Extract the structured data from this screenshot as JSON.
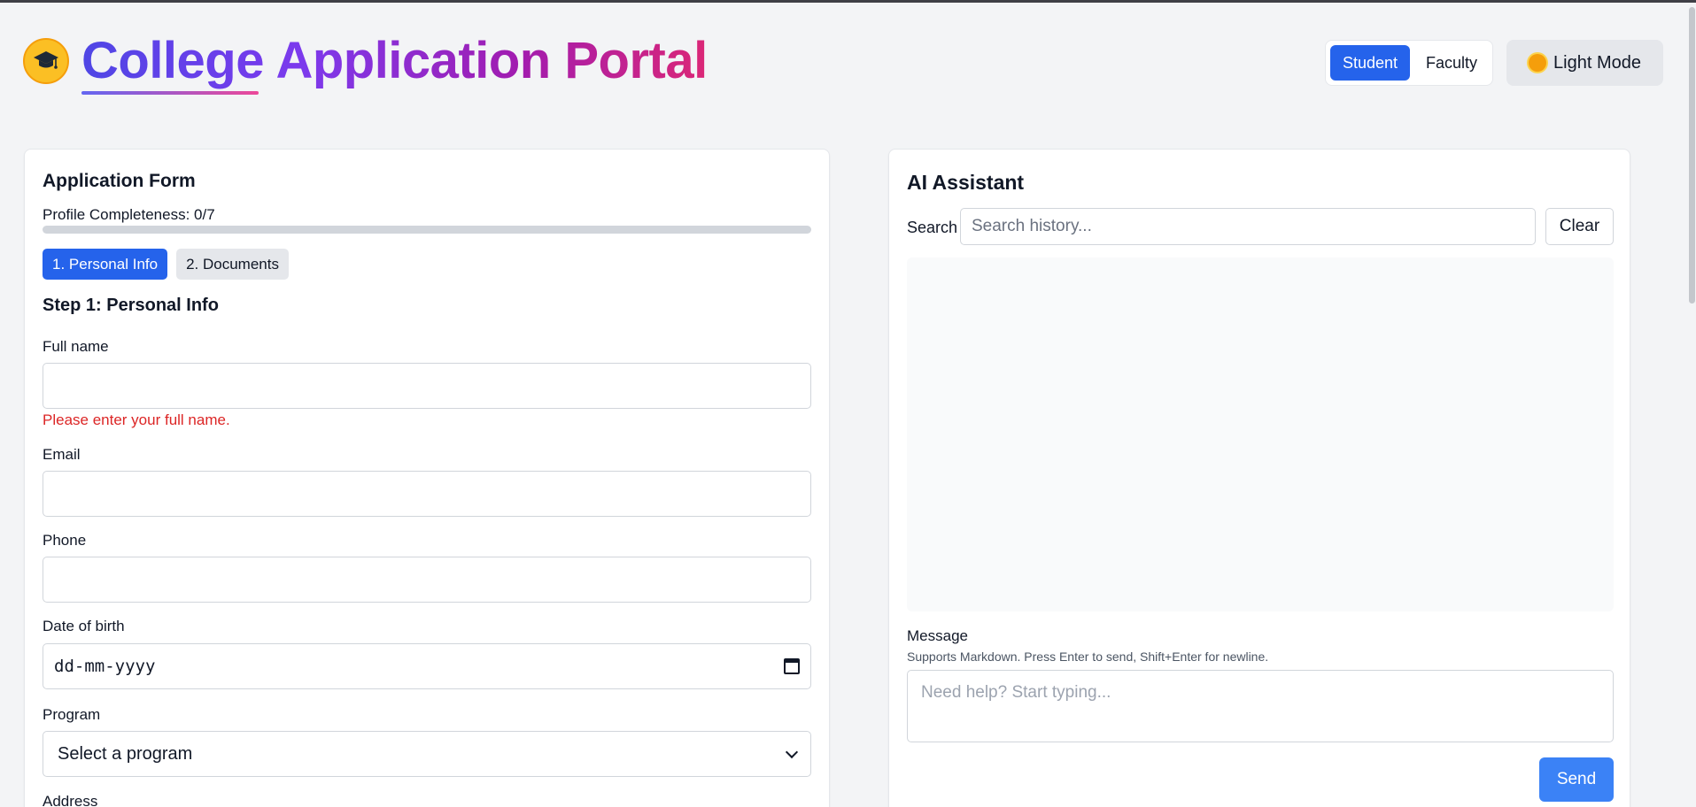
{
  "header": {
    "title": "College Application Portal",
    "logo_icon": "graduation-cap-icon",
    "roles": [
      "Student",
      "Faculty"
    ],
    "active_role": "Student",
    "mode_label": "Light Mode",
    "mode_icon": "sun-icon"
  },
  "form": {
    "title": "Application Form",
    "progress_label": "Profile Completeness: 0/7",
    "progress_fraction": 0,
    "steps": [
      "1. Personal Info",
      "2. Documents"
    ],
    "active_step": "1. Personal Info",
    "step_heading": "Step 1: Personal Info",
    "fields": {
      "full_name": {
        "label": "Full name",
        "value": "",
        "error": "Please enter your full name."
      },
      "email": {
        "label": "Email",
        "value": ""
      },
      "phone": {
        "label": "Phone",
        "value": ""
      },
      "dob": {
        "label": "Date of birth",
        "placeholder": "dd-mm-yyyy"
      },
      "program": {
        "label": "Program",
        "selected": "Select a program"
      },
      "address": {
        "label": "Address"
      }
    }
  },
  "assistant": {
    "title": "AI Assistant",
    "search_label": "Search",
    "search_placeholder": "Search history...",
    "clear_label": "Clear",
    "message_label": "Message",
    "message_hint": "Supports Markdown. Press Enter to send, Shift+Enter for newline.",
    "message_placeholder": "Need help? Start typing...",
    "send_label": "Send"
  },
  "colors": {
    "accent": "#2563eb",
    "send_button": "#3b82f6",
    "error": "#dc2626",
    "title_gradient_start": "#4f46e5",
    "title_gradient_end": "#db2777"
  }
}
